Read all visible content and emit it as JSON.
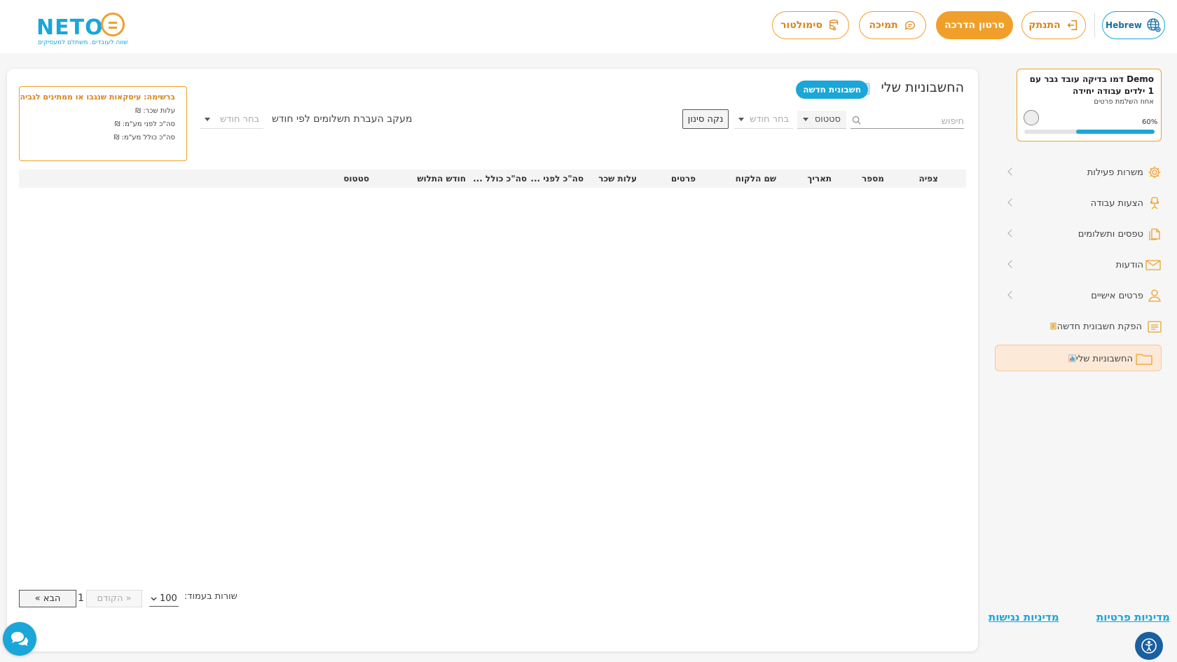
{
  "logo": {
    "word": "NETO",
    "tagline": "שווה לעובדים. משתלם למעסיקים"
  },
  "header": {
    "simulator_label": "סימולטור",
    "support_label": "תמיכה",
    "tutorial_label": "סרטון הדרכה",
    "logout_label": "התנתק",
    "language_label": "Hebrew"
  },
  "main": {
    "title": "החשבוניות שלי",
    "new_invoice_label": "חשבונית חדשה",
    "search_placeholder": "חיפוש",
    "status_label": "סטטוס",
    "month_placeholder": "בחר חודש",
    "clear_filter_label": "נקה סינון",
    "payment_tracking_label": "מעקב העברת תשלומים לפי חודש",
    "month_placeholder_2": "בחר חודש"
  },
  "summary": {
    "heading": "ברשימה:   עיסקאות שנגבו או ממתינים לגביה",
    "labor_cost": "עלות שכר: ₪",
    "total_before_vat": "סה\"כ לפני מע\"מ: ₪",
    "total_incl_vat": "סה\"כ כולל מע\"מ: ₪"
  },
  "table": {
    "columns": [
      "צפיה",
      "מספר",
      "תאריך",
      "שם הלקוח",
      "פרטים",
      "עלות שכר",
      "סה\"כ לפני ...",
      "סה\"כ כולל ...",
      "חודש התלוש",
      "סטטוס"
    ]
  },
  "pagination": {
    "next_label": "הבא »",
    "page_number": "1",
    "prev_label": "« הקודם",
    "page_size": "100",
    "rows_per_page_label": "שורות בעמוד:"
  },
  "profile": {
    "name": "Demo דמו בדיקה עובד גבר עם 1 ילדים עבודה יחידה",
    "completion_label": "אחוז השלמת פרטים",
    "completion_pct_text": "60%",
    "completion_fraction": 0.6
  },
  "sidebar": {
    "items": [
      {
        "label": "משרות פעילות",
        "icon": "gear-icon"
      },
      {
        "label": "הצעות עבודה",
        "icon": "chair-icon"
      },
      {
        "label": "טפסים ותשלומים",
        "icon": "documents-icon"
      },
      {
        "label": "הודעות",
        "icon": "envelope-icon"
      },
      {
        "label": "פרטים אישיים",
        "icon": "person-icon"
      },
      {
        "label": "הפקת חשבונית חדשה",
        "icon": "invoice-icon"
      },
      {
        "label": "החשבוניות שלי",
        "icon": "folder-icon"
      }
    ]
  },
  "footer": {
    "privacy_policy": "מדיניות פרטיות",
    "accessibility_policy": "מדיניות נגישות"
  },
  "colors": {
    "brand_blue": "#1aa6d8",
    "brand_orange": "#f0a02a",
    "active_nav_bg": "#fde9d8"
  }
}
